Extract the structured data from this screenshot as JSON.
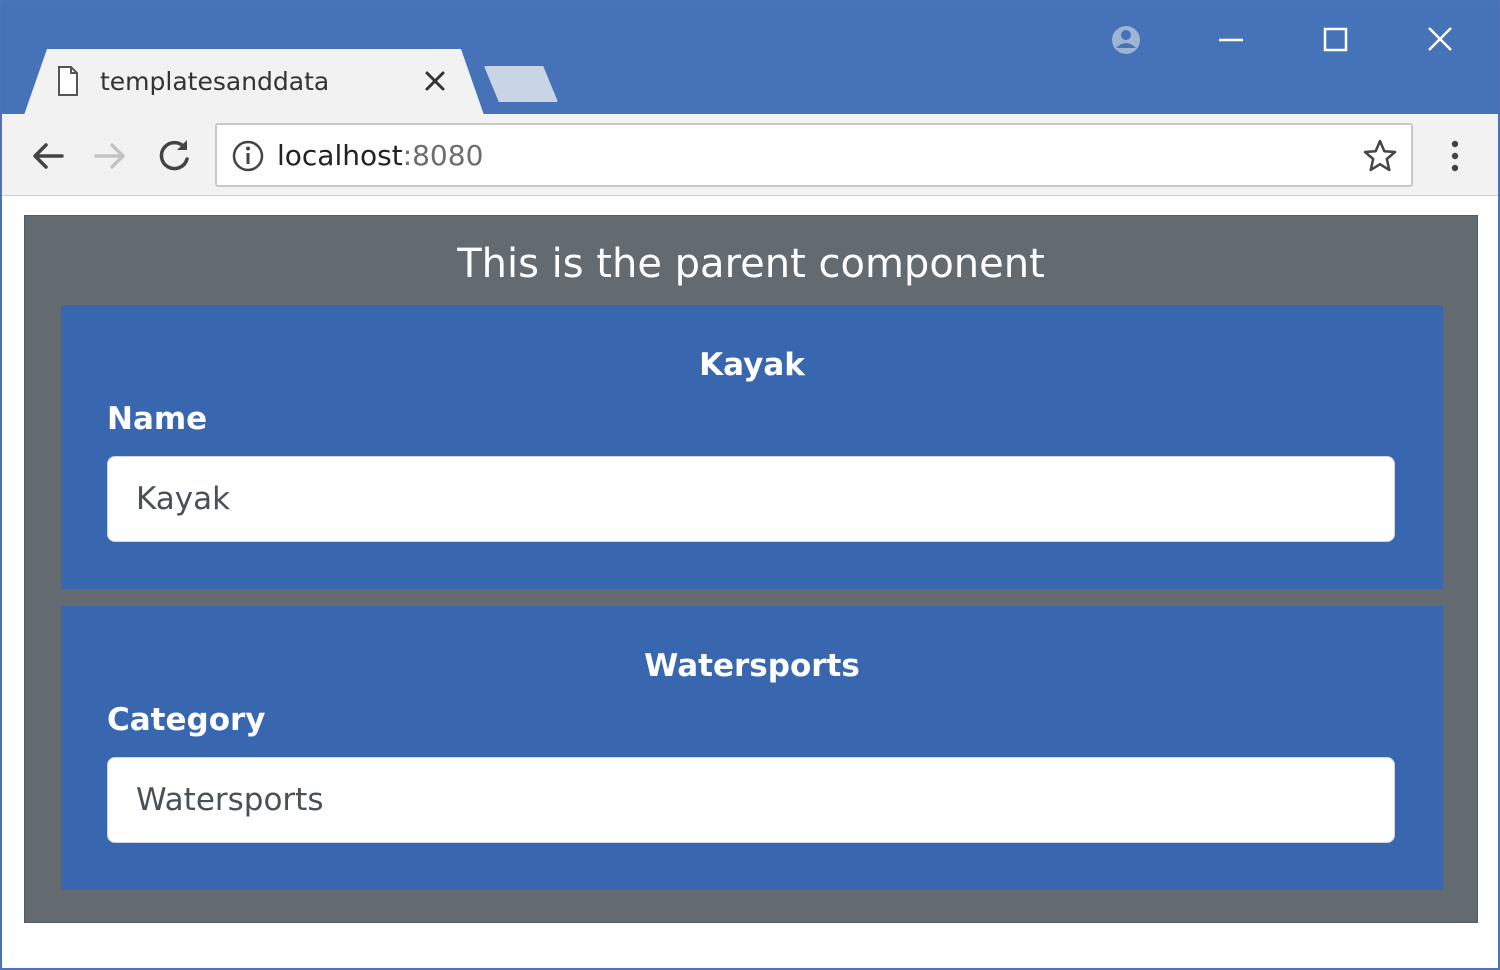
{
  "browser": {
    "tab_title": "templatesanddata",
    "url_host": "localhost",
    "url_port": ":8080"
  },
  "page": {
    "parent_title": "This is the parent component",
    "cards": [
      {
        "heading": "Kayak",
        "label": "Name",
        "input_value": "Kayak"
      },
      {
        "heading": "Watersports",
        "label": "Category",
        "input_value": "Watersports"
      }
    ]
  },
  "colors": {
    "titlebar": "#4673b8",
    "parent_panel": "#636b71",
    "child_card": "#3867b0"
  },
  "icons": [
    "page-icon",
    "close-icon",
    "profile-icon",
    "minimize-icon",
    "maximize-icon",
    "window-close-icon",
    "back-arrow-icon",
    "forward-arrow-icon",
    "reload-icon",
    "info-icon",
    "star-icon",
    "menu-icon"
  ]
}
